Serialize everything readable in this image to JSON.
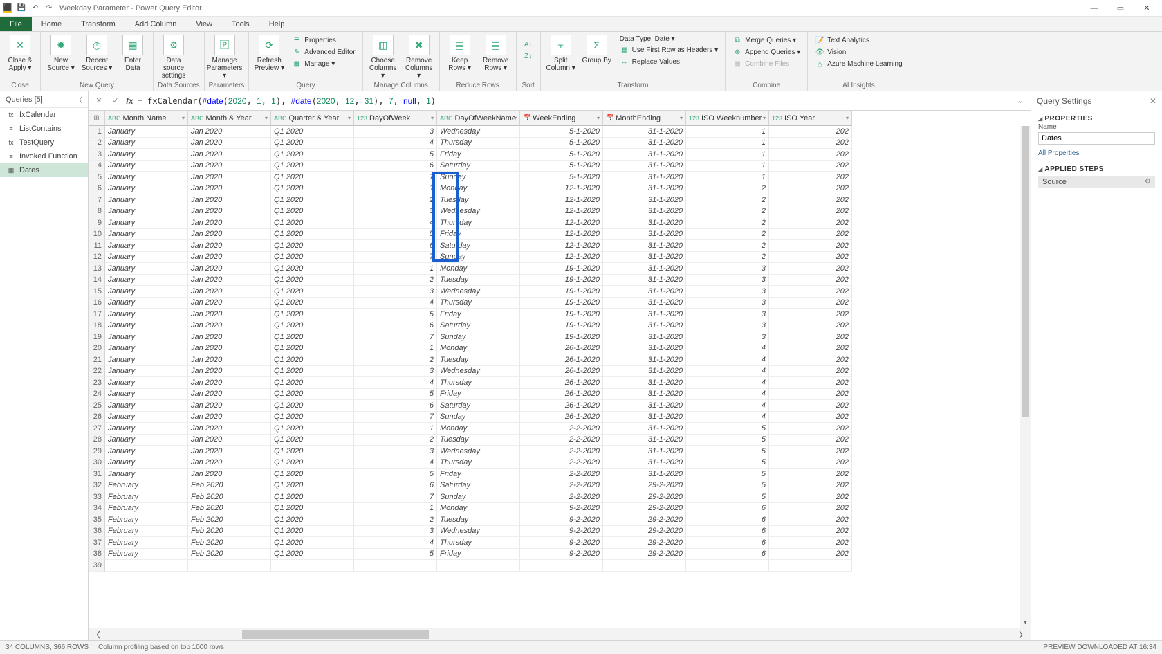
{
  "title": "Weekday Parameter - Power Query Editor",
  "tabs": [
    "File",
    "Home",
    "Transform",
    "Add Column",
    "View",
    "Tools",
    "Help"
  ],
  "ribbon": {
    "close": {
      "closeApply": "Close &\nApply ▾",
      "group": "Close"
    },
    "newquery": {
      "newSource": "New\nSource ▾",
      "recentSources": "Recent\nSources ▾",
      "enterData": "Enter\nData",
      "group": "New Query"
    },
    "datasources": {
      "dataSource": "Data source\nsettings",
      "group": "Data Sources"
    },
    "parameters": {
      "manageParams": "Manage\nParameters ▾",
      "group": "Parameters"
    },
    "query": {
      "refresh": "Refresh\nPreview ▾",
      "properties": "Properties",
      "advanced": "Advanced Editor",
      "manage": "Manage ▾",
      "group": "Query"
    },
    "managecols": {
      "choose": "Choose\nColumns ▾",
      "remove": "Remove\nColumns ▾",
      "group": "Manage Columns"
    },
    "reducerows": {
      "keep": "Keep\nRows ▾",
      "removerows": "Remove\nRows ▾",
      "group": "Reduce Rows"
    },
    "sort": {
      "group": "Sort"
    },
    "transform": {
      "split": "Split\nColumn ▾",
      "groupby": "Group\nBy",
      "datatype": "Data Type: Date ▾",
      "firstrow": "Use First Row as Headers ▾",
      "replace": "Replace Values",
      "group": "Transform"
    },
    "combine": {
      "merge": "Merge Queries ▾",
      "append": "Append Queries ▾",
      "combinefiles": "Combine Files",
      "group": "Combine"
    },
    "ai": {
      "text": "Text Analytics",
      "vision": "Vision",
      "aml": "Azure Machine Learning",
      "group": "AI Insights"
    }
  },
  "queriesPane": {
    "header": "Queries [5]",
    "items": [
      {
        "icon": "fx",
        "label": "fxCalendar"
      },
      {
        "icon": "≡",
        "label": "ListContains"
      },
      {
        "icon": "fx",
        "label": "TestQuery"
      },
      {
        "icon": "≡",
        "label": "Invoked Function"
      },
      {
        "icon": "▦",
        "label": "Dates",
        "selected": true
      }
    ]
  },
  "formula": "= fxCalendar(#date(2020, 1, 1), #date(2020, 12, 31), 7, null, 1)",
  "columns": [
    {
      "type": "ABC",
      "name": "Month Name"
    },
    {
      "type": "ABC",
      "name": "Month & Year"
    },
    {
      "type": "ABC",
      "name": "Quarter & Year"
    },
    {
      "type": "123",
      "name": "DayOfWeek"
    },
    {
      "type": "ABC",
      "name": "DayOfWeekName"
    },
    {
      "type": "📅",
      "name": "WeekEnding"
    },
    {
      "type": "📅",
      "name": "MonthEnding"
    },
    {
      "type": "123",
      "name": "ISO Weeknumber"
    },
    {
      "type": "123",
      "name": "ISO Year"
    }
  ],
  "rows": [
    {
      "n": 1,
      "m": "January",
      "my": "Jan 2020",
      "qy": "Q1 2020",
      "dow": 3,
      "down": "Wednesday",
      "we": "5-1-2020",
      "me": "31-1-2020",
      "iw": 1,
      "iy": "202"
    },
    {
      "n": 2,
      "m": "January",
      "my": "Jan 2020",
      "qy": "Q1 2020",
      "dow": 4,
      "down": "Thursday",
      "we": "5-1-2020",
      "me": "31-1-2020",
      "iw": 1,
      "iy": "202"
    },
    {
      "n": 3,
      "m": "January",
      "my": "Jan 2020",
      "qy": "Q1 2020",
      "dow": 5,
      "down": "Friday",
      "we": "5-1-2020",
      "me": "31-1-2020",
      "iw": 1,
      "iy": "202"
    },
    {
      "n": 4,
      "m": "January",
      "my": "Jan 2020",
      "qy": "Q1 2020",
      "dow": 6,
      "down": "Saturday",
      "we": "5-1-2020",
      "me": "31-1-2020",
      "iw": 1,
      "iy": "202"
    },
    {
      "n": 5,
      "m": "January",
      "my": "Jan 2020",
      "qy": "Q1 2020",
      "dow": 7,
      "down": "Sunday",
      "we": "5-1-2020",
      "me": "31-1-2020",
      "iw": 1,
      "iy": "202"
    },
    {
      "n": 6,
      "m": "January",
      "my": "Jan 2020",
      "qy": "Q1 2020",
      "dow": 1,
      "down": "Monday",
      "we": "12-1-2020",
      "me": "31-1-2020",
      "iw": 2,
      "iy": "202"
    },
    {
      "n": 7,
      "m": "January",
      "my": "Jan 2020",
      "qy": "Q1 2020",
      "dow": 2,
      "down": "Tuesday",
      "we": "12-1-2020",
      "me": "31-1-2020",
      "iw": 2,
      "iy": "202"
    },
    {
      "n": 8,
      "m": "January",
      "my": "Jan 2020",
      "qy": "Q1 2020",
      "dow": 3,
      "down": "Wednesday",
      "we": "12-1-2020",
      "me": "31-1-2020",
      "iw": 2,
      "iy": "202"
    },
    {
      "n": 9,
      "m": "January",
      "my": "Jan 2020",
      "qy": "Q1 2020",
      "dow": 4,
      "down": "Thursday",
      "we": "12-1-2020",
      "me": "31-1-2020",
      "iw": 2,
      "iy": "202"
    },
    {
      "n": 10,
      "m": "January",
      "my": "Jan 2020",
      "qy": "Q1 2020",
      "dow": 5,
      "down": "Friday",
      "we": "12-1-2020",
      "me": "31-1-2020",
      "iw": 2,
      "iy": "202"
    },
    {
      "n": 11,
      "m": "January",
      "my": "Jan 2020",
      "qy": "Q1 2020",
      "dow": 6,
      "down": "Saturday",
      "we": "12-1-2020",
      "me": "31-1-2020",
      "iw": 2,
      "iy": "202"
    },
    {
      "n": 12,
      "m": "January",
      "my": "Jan 2020",
      "qy": "Q1 2020",
      "dow": 7,
      "down": "Sunday",
      "we": "12-1-2020",
      "me": "31-1-2020",
      "iw": 2,
      "iy": "202"
    },
    {
      "n": 13,
      "m": "January",
      "my": "Jan 2020",
      "qy": "Q1 2020",
      "dow": 1,
      "down": "Monday",
      "we": "19-1-2020",
      "me": "31-1-2020",
      "iw": 3,
      "iy": "202"
    },
    {
      "n": 14,
      "m": "January",
      "my": "Jan 2020",
      "qy": "Q1 2020",
      "dow": 2,
      "down": "Tuesday",
      "we": "19-1-2020",
      "me": "31-1-2020",
      "iw": 3,
      "iy": "202"
    },
    {
      "n": 15,
      "m": "January",
      "my": "Jan 2020",
      "qy": "Q1 2020",
      "dow": 3,
      "down": "Wednesday",
      "we": "19-1-2020",
      "me": "31-1-2020",
      "iw": 3,
      "iy": "202"
    },
    {
      "n": 16,
      "m": "January",
      "my": "Jan 2020",
      "qy": "Q1 2020",
      "dow": 4,
      "down": "Thursday",
      "we": "19-1-2020",
      "me": "31-1-2020",
      "iw": 3,
      "iy": "202"
    },
    {
      "n": 17,
      "m": "January",
      "my": "Jan 2020",
      "qy": "Q1 2020",
      "dow": 5,
      "down": "Friday",
      "we": "19-1-2020",
      "me": "31-1-2020",
      "iw": 3,
      "iy": "202"
    },
    {
      "n": 18,
      "m": "January",
      "my": "Jan 2020",
      "qy": "Q1 2020",
      "dow": 6,
      "down": "Saturday",
      "we": "19-1-2020",
      "me": "31-1-2020",
      "iw": 3,
      "iy": "202"
    },
    {
      "n": 19,
      "m": "January",
      "my": "Jan 2020",
      "qy": "Q1 2020",
      "dow": 7,
      "down": "Sunday",
      "we": "19-1-2020",
      "me": "31-1-2020",
      "iw": 3,
      "iy": "202"
    },
    {
      "n": 20,
      "m": "January",
      "my": "Jan 2020",
      "qy": "Q1 2020",
      "dow": 1,
      "down": "Monday",
      "we": "26-1-2020",
      "me": "31-1-2020",
      "iw": 4,
      "iy": "202"
    },
    {
      "n": 21,
      "m": "January",
      "my": "Jan 2020",
      "qy": "Q1 2020",
      "dow": 2,
      "down": "Tuesday",
      "we": "26-1-2020",
      "me": "31-1-2020",
      "iw": 4,
      "iy": "202"
    },
    {
      "n": 22,
      "m": "January",
      "my": "Jan 2020",
      "qy": "Q1 2020",
      "dow": 3,
      "down": "Wednesday",
      "we": "26-1-2020",
      "me": "31-1-2020",
      "iw": 4,
      "iy": "202"
    },
    {
      "n": 23,
      "m": "January",
      "my": "Jan 2020",
      "qy": "Q1 2020",
      "dow": 4,
      "down": "Thursday",
      "we": "26-1-2020",
      "me": "31-1-2020",
      "iw": 4,
      "iy": "202"
    },
    {
      "n": 24,
      "m": "January",
      "my": "Jan 2020",
      "qy": "Q1 2020",
      "dow": 5,
      "down": "Friday",
      "we": "26-1-2020",
      "me": "31-1-2020",
      "iw": 4,
      "iy": "202"
    },
    {
      "n": 25,
      "m": "January",
      "my": "Jan 2020",
      "qy": "Q1 2020",
      "dow": 6,
      "down": "Saturday",
      "we": "26-1-2020",
      "me": "31-1-2020",
      "iw": 4,
      "iy": "202"
    },
    {
      "n": 26,
      "m": "January",
      "my": "Jan 2020",
      "qy": "Q1 2020",
      "dow": 7,
      "down": "Sunday",
      "we": "26-1-2020",
      "me": "31-1-2020",
      "iw": 4,
      "iy": "202"
    },
    {
      "n": 27,
      "m": "January",
      "my": "Jan 2020",
      "qy": "Q1 2020",
      "dow": 1,
      "down": "Monday",
      "we": "2-2-2020",
      "me": "31-1-2020",
      "iw": 5,
      "iy": "202"
    },
    {
      "n": 28,
      "m": "January",
      "my": "Jan 2020",
      "qy": "Q1 2020",
      "dow": 2,
      "down": "Tuesday",
      "we": "2-2-2020",
      "me": "31-1-2020",
      "iw": 5,
      "iy": "202"
    },
    {
      "n": 29,
      "m": "January",
      "my": "Jan 2020",
      "qy": "Q1 2020",
      "dow": 3,
      "down": "Wednesday",
      "we": "2-2-2020",
      "me": "31-1-2020",
      "iw": 5,
      "iy": "202"
    },
    {
      "n": 30,
      "m": "January",
      "my": "Jan 2020",
      "qy": "Q1 2020",
      "dow": 4,
      "down": "Thursday",
      "we": "2-2-2020",
      "me": "31-1-2020",
      "iw": 5,
      "iy": "202"
    },
    {
      "n": 31,
      "m": "January",
      "my": "Jan 2020",
      "qy": "Q1 2020",
      "dow": 5,
      "down": "Friday",
      "we": "2-2-2020",
      "me": "31-1-2020",
      "iw": 5,
      "iy": "202"
    },
    {
      "n": 32,
      "m": "February",
      "my": "Feb 2020",
      "qy": "Q1 2020",
      "dow": 6,
      "down": "Saturday",
      "we": "2-2-2020",
      "me": "29-2-2020",
      "iw": 5,
      "iy": "202"
    },
    {
      "n": 33,
      "m": "February",
      "my": "Feb 2020",
      "qy": "Q1 2020",
      "dow": 7,
      "down": "Sunday",
      "we": "2-2-2020",
      "me": "29-2-2020",
      "iw": 5,
      "iy": "202"
    },
    {
      "n": 34,
      "m": "February",
      "my": "Feb 2020",
      "qy": "Q1 2020",
      "dow": 1,
      "down": "Monday",
      "we": "9-2-2020",
      "me": "29-2-2020",
      "iw": 6,
      "iy": "202"
    },
    {
      "n": 35,
      "m": "February",
      "my": "Feb 2020",
      "qy": "Q1 2020",
      "dow": 2,
      "down": "Tuesday",
      "we": "9-2-2020",
      "me": "29-2-2020",
      "iw": 6,
      "iy": "202"
    },
    {
      "n": 36,
      "m": "February",
      "my": "Feb 2020",
      "qy": "Q1 2020",
      "dow": 3,
      "down": "Wednesday",
      "we": "9-2-2020",
      "me": "29-2-2020",
      "iw": 6,
      "iy": "202"
    },
    {
      "n": 37,
      "m": "February",
      "my": "Feb 2020",
      "qy": "Q1 2020",
      "dow": 4,
      "down": "Thursday",
      "we": "9-2-2020",
      "me": "29-2-2020",
      "iw": 6,
      "iy": "202"
    },
    {
      "n": 38,
      "m": "February",
      "my": "Feb 2020",
      "qy": "Q1 2020",
      "dow": 5,
      "down": "Friday",
      "we": "9-2-2020",
      "me": "29-2-2020",
      "iw": 6,
      "iy": "202"
    },
    {
      "n": 39,
      "m": "",
      "my": "",
      "qy": "",
      "dow": "",
      "down": "",
      "we": "",
      "me": "",
      "iw": "",
      "iy": ""
    }
  ],
  "settings": {
    "header": "Query Settings",
    "propTitle": "PROPERTIES",
    "nameLabel": "Name",
    "nameValue": "Dates",
    "allProps": "All Properties",
    "stepsTitle": "APPLIED STEPS",
    "step": "Source"
  },
  "status": {
    "left": "34 COLUMNS, 366 ROWS",
    "mid": "Column profiling based on top 1000 rows",
    "right": "PREVIEW DOWNLOADED AT 16:34"
  }
}
